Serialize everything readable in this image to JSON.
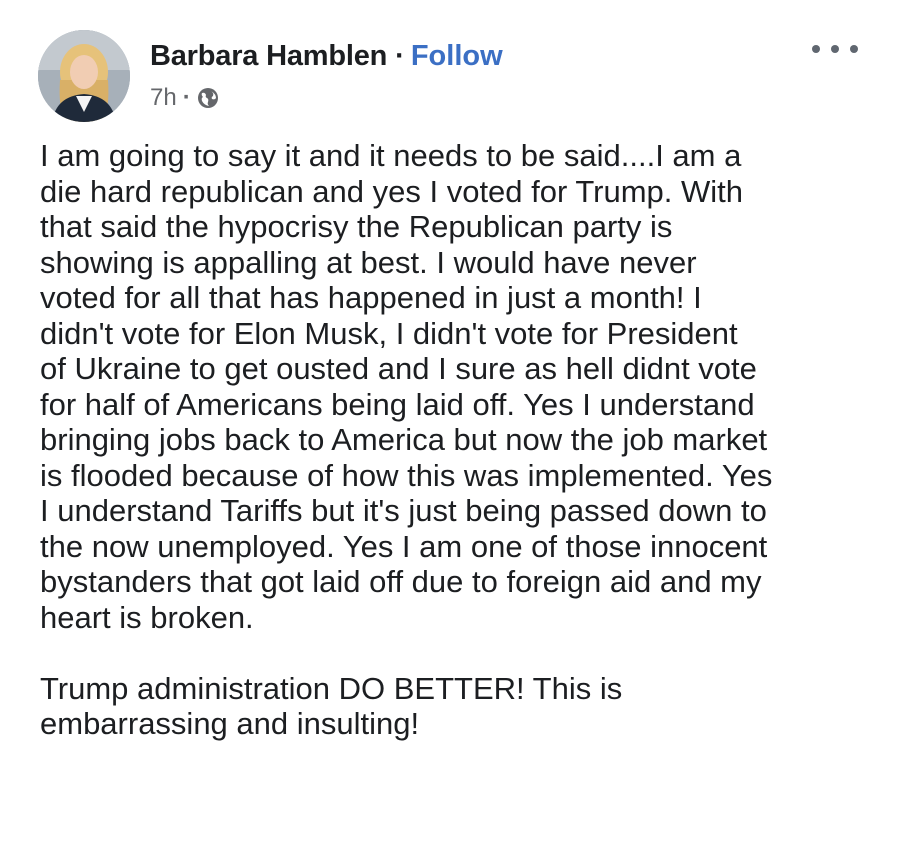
{
  "post": {
    "author": {
      "name": "Barbara Hamblen",
      "separator": "·",
      "follow_label": "Follow"
    },
    "meta": {
      "timestamp": "7h",
      "separator": "·",
      "audience_icon": "globe-icon"
    },
    "more_icon": "more-options-icon",
    "body": {
      "paragraph1_lines": [
        "I am going to say it and it needs to be said....I am a",
        "die hard republican and yes I voted for Trump. With",
        "that said the hypocrisy the Republican party is",
        "showing is appalling at best. I would have never",
        "voted for all that has happened in just a month! I",
        "didn't vote for Elon Musk, I didn't vote for President",
        "of Ukraine to get ousted and I sure as hell didnt vote",
        "for half of Americans being laid off.  Yes I understand",
        "bringing jobs back to America but now the job market",
        "is flooded because of how this was implemented. Yes",
        "I understand Tariffs but it's just being passed down to",
        "the now unemployed. Yes I am one of those innocent",
        "bystanders that got laid off due to foreign aid and my",
        "heart is broken."
      ],
      "paragraph2_lines": [
        "Trump administration DO BETTER! This is",
        "embarrassing and insulting!"
      ]
    }
  },
  "colors": {
    "link": "#3b6fc4",
    "text": "#1c1e21",
    "meta": "#65676b"
  }
}
